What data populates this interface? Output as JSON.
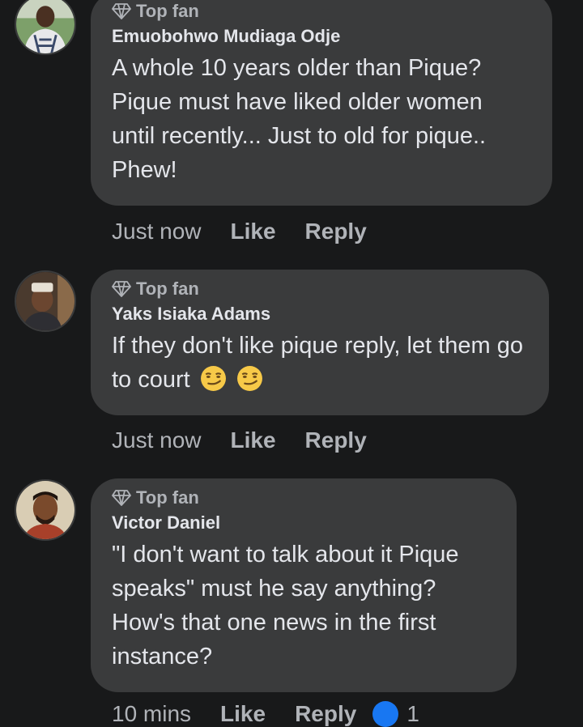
{
  "comments": [
    {
      "badge": "Top fan",
      "author": "Emuobohwo Mudiaga Odje",
      "text": "A whole 10 years older than Pique? Pique must have liked older women until recently... Just to old for pique.. Phew!",
      "time": "Just now",
      "like": "Like",
      "reply": "Reply"
    },
    {
      "badge": "Top fan",
      "author": "Yaks Isiaka Adams",
      "text": "If they don't like pique reply, let them go to court",
      "emojis": [
        "smirk-emoji",
        "smirk-emoji"
      ],
      "time": "Just now",
      "like": "Like",
      "reply": "Reply"
    },
    {
      "badge": "Top fan",
      "author": "Victor Daniel",
      "text": "\"I don't want to talk about it Pique speaks\" must he say anything? How's that one news in the first instance?",
      "time": "10 mins",
      "like": "Like",
      "reply": "Reply",
      "reaction_count": "1"
    }
  ],
  "colors": {
    "background": "#18191a",
    "bubble": "#3a3b3c",
    "text": "#e4e6eb",
    "muted": "#b0b3b8",
    "reaction": "#1877f2"
  }
}
